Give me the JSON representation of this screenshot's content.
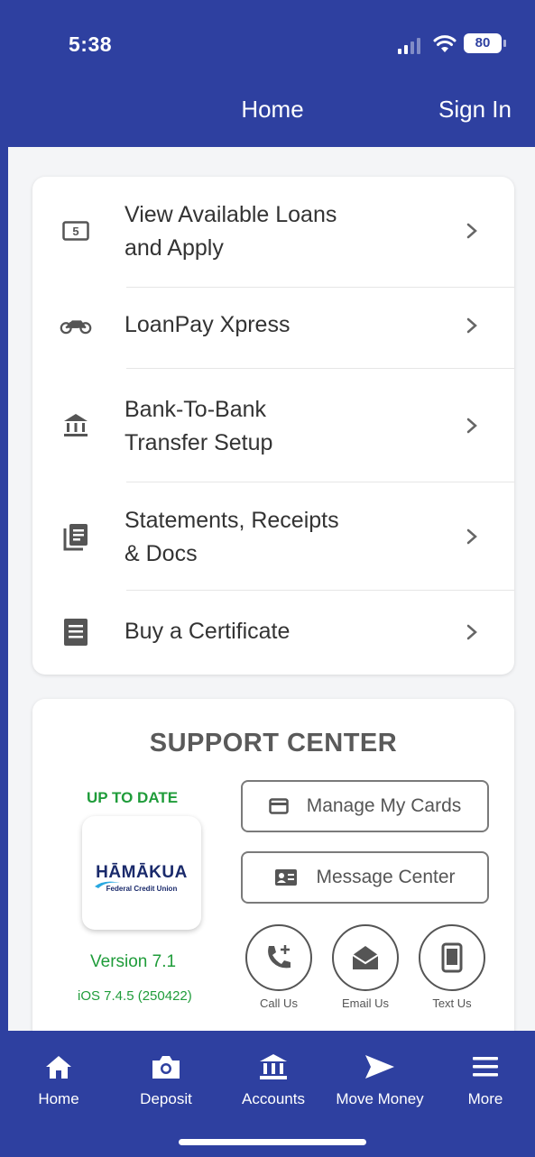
{
  "status_bar": {
    "time": "5:38",
    "battery": "80"
  },
  "header": {
    "title": "Home",
    "sign_in": "Sign In"
  },
  "menu": {
    "items": [
      {
        "label_lines": [
          "View Available Loans",
          "and Apply"
        ],
        "icon": "loan-dollar-icon"
      },
      {
        "label_lines": [
          "LoanPay Xpress"
        ],
        "icon": "motorcycle-icon"
      },
      {
        "label_lines": [
          "Bank-To-Bank",
          "Transfer Setup"
        ],
        "icon": "bank-icon"
      },
      {
        "label_lines": [
          "Statements, Receipts",
          "& Docs"
        ],
        "icon": "documents-icon"
      },
      {
        "label_lines": [
          "Buy a Certificate"
        ],
        "icon": "certificate-icon"
      }
    ]
  },
  "support": {
    "title": "SUPPORT CENTER",
    "status": "UP TO DATE",
    "logo_name": "HĀMĀKUA",
    "logo_sub": "Federal Credit Union",
    "version": "Version 7.1",
    "ios_version": "iOS 7.4.5 (250422)",
    "manage_cards": "Manage My Cards",
    "message_center": "Message Center",
    "call_us": "Call Us",
    "email_us": "Email Us",
    "text_us": "Text Us"
  },
  "bottom_nav": {
    "items": [
      {
        "label": "Home",
        "icon": "home-icon"
      },
      {
        "label": "Deposit",
        "icon": "camera-icon"
      },
      {
        "label": "Accounts",
        "icon": "bank-icon"
      },
      {
        "label": "Move Money",
        "icon": "send-icon"
      },
      {
        "label": "More",
        "icon": "menu-icon"
      }
    ]
  },
  "colors": {
    "brand": "#2e40a0",
    "green": "#1f9c3a",
    "text": "#333333"
  }
}
